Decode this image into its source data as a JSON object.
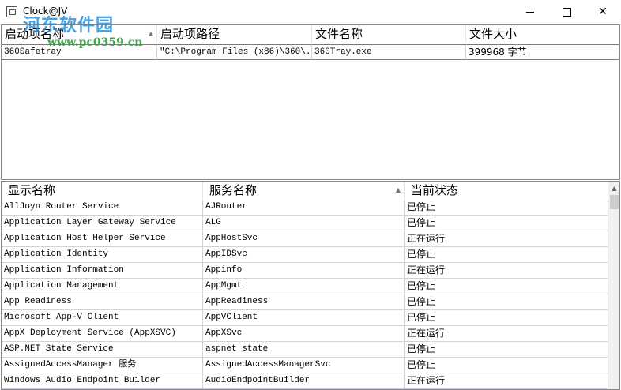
{
  "window": {
    "title": "Clock@JV",
    "watermark": "河东软件园",
    "watermark_url": "www.pc0359.cn",
    "minimize_icon": "minimize-icon",
    "maximize_icon": "maximize-icon",
    "close_icon": "close-icon",
    "close_glyph": "✕"
  },
  "startup": {
    "columns": [
      "启动项名称",
      "启动项路径",
      "文件名称",
      "文件大小"
    ],
    "sort_glyph": "▲",
    "rows": [
      [
        "360Safetray",
        "\"C:\\Program Files (x86)\\360\\...",
        "360Tray.exe",
        "399968 字节"
      ]
    ]
  },
  "services": {
    "columns": [
      "显示名称",
      "服务名称",
      "当前状态"
    ],
    "sort_glyph": "▲",
    "scroll_up_glyph": "▲",
    "rows": [
      [
        "AllJoyn Router Service",
        "AJRouter",
        "已停止"
      ],
      [
        "Application Layer Gateway Service",
        "ALG",
        "已停止"
      ],
      [
        "Application Host Helper Service",
        "AppHostSvc",
        "正在运行"
      ],
      [
        "Application Identity",
        "AppIDSvc",
        "已停止"
      ],
      [
        "Application Information",
        "Appinfo",
        "正在运行"
      ],
      [
        "Application Management",
        "AppMgmt",
        "已停止"
      ],
      [
        "App Readiness",
        "AppReadiness",
        "已停止"
      ],
      [
        "Microsoft App-V Client",
        "AppVClient",
        "已停止"
      ],
      [
        "AppX Deployment Service (AppXSVC)",
        "AppXSvc",
        "正在运行"
      ],
      [
        "ASP.NET State Service",
        "aspnet_state",
        "已停止"
      ],
      [
        "AssignedAccessManager 服务",
        "AssignedAccessManagerSvc",
        "已停止"
      ],
      [
        "Windows Audio Endpoint Builder",
        "AudioEndpointBuilder",
        "正在运行"
      ]
    ]
  }
}
